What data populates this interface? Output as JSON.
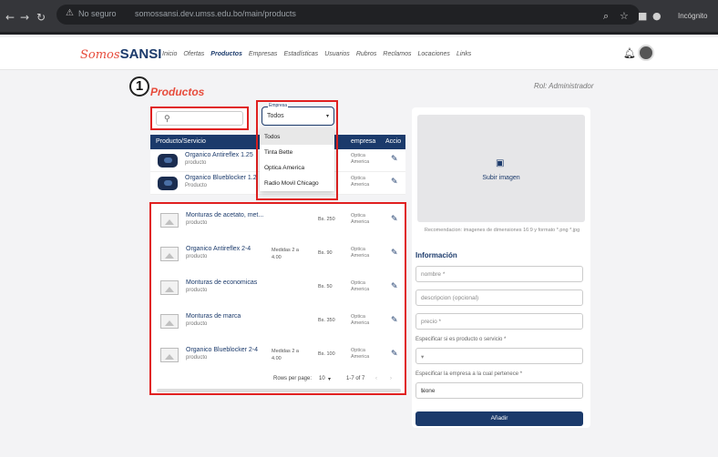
{
  "browser": {
    "not_secure": "No seguro",
    "url": "somossansi.dev.umss.edu.bo/main/products",
    "incognito": "Incógnito"
  },
  "app": {
    "logo_script": "Somos",
    "logo_bold": "SANSI",
    "nav": [
      "Inicio",
      "Ofertas",
      "Productos",
      "Empresas",
      "Estadísticas",
      "Usuarios",
      "Rubros",
      "Reclamos",
      "Locaciones",
      "Links"
    ],
    "active_nav": "Productos",
    "role": "Rol: Administrador"
  },
  "page": {
    "step_number": "1",
    "title": "Productos"
  },
  "filters": {
    "empresa_label": "Empresa",
    "empresa_value": "Todos",
    "empresa_options": [
      "Todos",
      "Tinta Bette",
      "Optica America",
      "Radio Movil Chicago"
    ]
  },
  "table": {
    "headers": {
      "product": "Producto/Servicio",
      "empresa": "empresa",
      "acciones": "Accio"
    },
    "top_rows": [
      {
        "name": "Organico Antireflex 1.25",
        "type": "producto",
        "empresa": "Optica America"
      },
      {
        "name": "Organico Blueblocker 1.2",
        "type": "Producto",
        "empresa": "Optica America"
      }
    ],
    "rows": [
      {
        "name": "Monturas de acetato, met...",
        "type": "producto",
        "medidas": "",
        "price": "Bs. 250",
        "empresa": "Optica America"
      },
      {
        "name": "Organico Antireflex 2-4",
        "type": "producto",
        "medidas": "Medidas 2 a 4.00",
        "price": "Bs. 90",
        "empresa": "Optica America"
      },
      {
        "name": "Monturas de economicas",
        "type": "producto",
        "medidas": "",
        "price": "Bs. 50",
        "empresa": "Optica America"
      },
      {
        "name": "Monturas de marca",
        "type": "producto",
        "medidas": "",
        "price": "Bs. 350",
        "empresa": "Optica America"
      },
      {
        "name": "Organico Blueblocker 2-4",
        "type": "producto",
        "medidas": "Medidas 2 a 4.00",
        "price": "Bs. 100",
        "empresa": "Optica America"
      }
    ],
    "pagination": {
      "rows_per_page_label": "Rows per page:",
      "rows_per_page": "10",
      "range": "1-7 of 7"
    }
  },
  "form": {
    "upload_label": "Subir imagen",
    "recommendation": "Recomendacion: imagenes de dimensiones 16:9 y formato *.png *.jpg",
    "section_title": "Información",
    "nombre_placeholder": "nombre *",
    "descripcion_placeholder": "descripcion (opcional)",
    "precio_placeholder": "precio *",
    "tipo_label": "Especificar si es producto o servicio *",
    "tipo_value": "",
    "empresa_label": "Especificar la empresa a la cual pertenece *",
    "empresa_value": "None",
    "submit": "Añadir"
  },
  "colors": {
    "brand_navy": "#1b3a6b",
    "brand_red": "#e74c3c",
    "annotation_red": "#e02020"
  }
}
